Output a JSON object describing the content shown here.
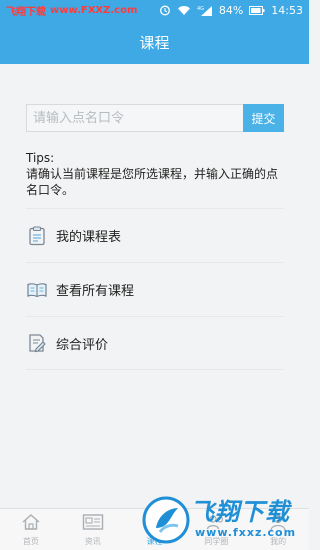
{
  "status_bar": {
    "brand": "飞翔下载",
    "site": "www.FXXZ.com",
    "battery": "84%",
    "time": "14:53",
    "network": "4G"
  },
  "header": {
    "title": "课程"
  },
  "attendance": {
    "placeholder": "请输入点名口令",
    "value": "",
    "submit_label": "提交"
  },
  "tips": {
    "title": "Tips:",
    "text": "请确认当前课程是您所选课程，并输入正确的点名口令。"
  },
  "menu": {
    "items": [
      {
        "label": "我的课程表",
        "icon": "clipboard-icon"
      },
      {
        "label": "查看所有课程",
        "icon": "book-icon"
      },
      {
        "label": "综合评价",
        "icon": "edit-icon"
      }
    ]
  },
  "watermark": {
    "title": "飞翔下载",
    "sub": "www.fxxz.com"
  },
  "bottom_nav": {
    "items": [
      {
        "label": "首页",
        "icon": "home-icon"
      },
      {
        "label": "资讯",
        "icon": "news-icon"
      },
      {
        "label": "课程",
        "icon": "course-icon"
      },
      {
        "label": "同学圈",
        "icon": "friends-icon"
      },
      {
        "label": "我的",
        "icon": "profile-icon"
      }
    ],
    "active_index": 2
  },
  "colors": {
    "primary": "#3fa9e6",
    "background": "#f2f3f4"
  }
}
